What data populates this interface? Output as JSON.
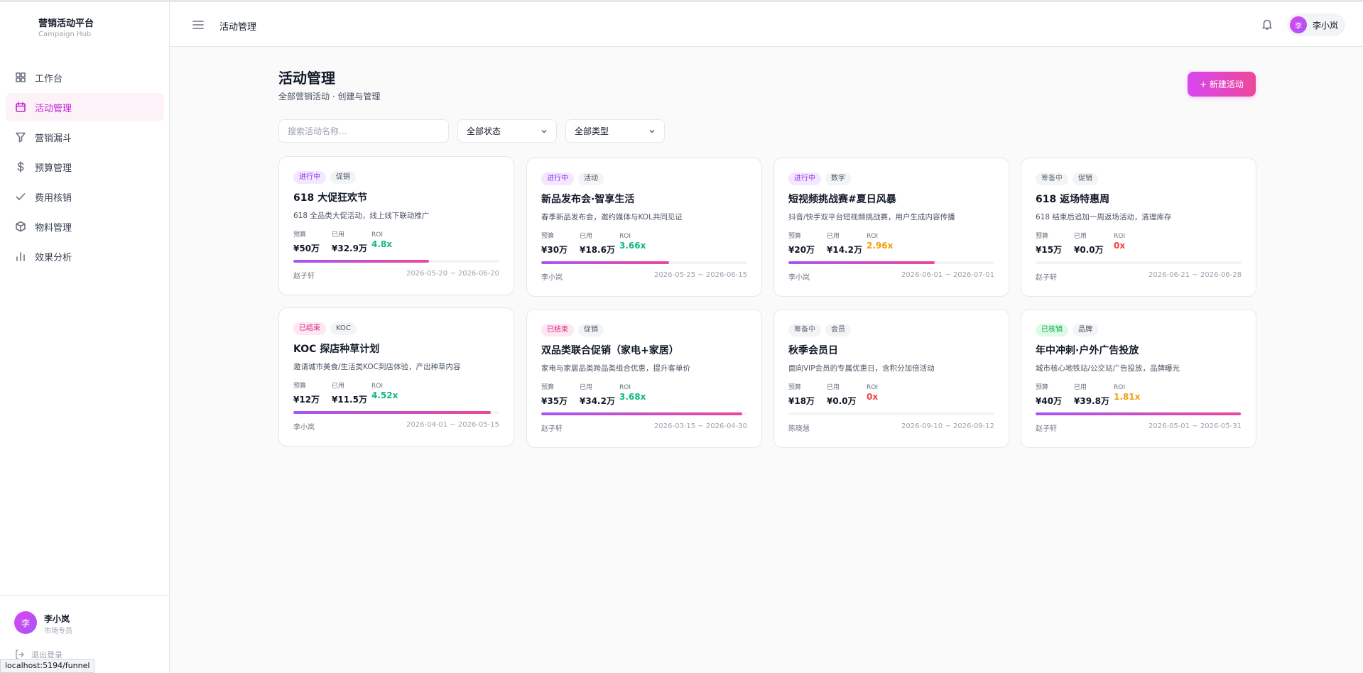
{
  "app": {
    "title": "营销活动平台",
    "subtitle": "Campaign Hub"
  },
  "sidebar": {
    "items": [
      {
        "label": "工作台",
        "icon": "grid-icon",
        "active": false
      },
      {
        "label": "活动管理",
        "icon": "calendar-icon",
        "active": true
      },
      {
        "label": "营销漏斗",
        "icon": "funnel-icon",
        "active": false
      },
      {
        "label": "预算管理",
        "icon": "dollar-icon",
        "active": false
      },
      {
        "label": "费用核销",
        "icon": "check-icon",
        "active": false
      },
      {
        "label": "物料管理",
        "icon": "box-icon",
        "active": false
      },
      {
        "label": "效果分析",
        "icon": "bar-chart-icon",
        "active": false
      }
    ],
    "user": {
      "avatar": "李",
      "name": "李小岚",
      "role": "市场专员"
    },
    "logout": "退出登录"
  },
  "status_url": "localhost:5194/funnel",
  "header": {
    "title": "活动管理",
    "user": {
      "avatar": "李",
      "name": "李小岚"
    }
  },
  "page": {
    "title": "活动管理",
    "subtitle": "全部营销活动 · 创建与管理",
    "new_button": "+ 新建活动",
    "search_placeholder": "搜索活动名称...",
    "status_filter": "全部状态",
    "type_filter": "全部类型"
  },
  "labels": {
    "budget": "预算",
    "spent": "已用",
    "roi": "ROI"
  },
  "colors": {
    "accent": "#c026d3",
    "roi_good": "#10b981",
    "roi_mid": "#f59e0b",
    "roi_zero": "#ef4444"
  },
  "campaigns": [
    {
      "status": "进行中",
      "status_class": "st-active",
      "type": "促销",
      "title": "618 大促狂欢节",
      "desc": "618 全品类大促活动，线上线下联动推广",
      "budget": "¥50万",
      "spent": "¥32.9万",
      "roi": "4.8x",
      "roi_color": "#10b981",
      "progress": 0.658,
      "owner": "赵子轩",
      "dates": "2026-05-20 ~ 2026-06-20"
    },
    {
      "status": "进行中",
      "status_class": "st-active",
      "type": "活动",
      "title": "新品发布会·智享生活",
      "desc": "春季新品发布会，邀约媒体与KOL共同见证",
      "budget": "¥30万",
      "spent": "¥18.6万",
      "roi": "3.66x",
      "roi_color": "#10b981",
      "progress": 0.62,
      "owner": "李小岚",
      "dates": "2026-05-25 ~ 2026-06-15"
    },
    {
      "status": "进行中",
      "status_class": "st-active",
      "type": "数字",
      "title": "短视频挑战赛#夏日风暴",
      "desc": "抖音/快手双平台短视频挑战赛，用户生成内容传播",
      "budget": "¥20万",
      "spent": "¥14.2万",
      "roi": "2.96x",
      "roi_color": "#f59e0b",
      "progress": 0.71,
      "owner": "李小岚",
      "dates": "2026-06-01 ~ 2026-07-01"
    },
    {
      "status": "筹备中",
      "status_class": "st-prep",
      "type": "促销",
      "title": "618 返场特惠周",
      "desc": "618 结束后追加一周返场活动，清理库存",
      "budget": "¥15万",
      "spent": "¥0.0万",
      "roi": "0x",
      "roi_color": "#ef4444",
      "progress": 0,
      "owner": "赵子轩",
      "dates": "2026-06-21 ~ 2026-06-28"
    },
    {
      "status": "已结束",
      "status_class": "st-ended",
      "type": "KOC",
      "title": "KOC 探店种草计划",
      "desc": "邀请城市美食/生活类KOC到店体验，产出种草内容",
      "budget": "¥12万",
      "spent": "¥11.5万",
      "roi": "4.52x",
      "roi_color": "#10b981",
      "progress": 0.958,
      "owner": "李小岚",
      "dates": "2026-04-01 ~ 2026-05-15"
    },
    {
      "status": "已结束",
      "status_class": "st-ended",
      "type": "促销",
      "title": "双品类联合促销（家电+家居）",
      "desc": "家电与家居品类跨品类组合优惠，提升客单价",
      "budget": "¥35万",
      "spent": "¥34.2万",
      "roi": "3.68x",
      "roi_color": "#10b981",
      "progress": 0.977,
      "owner": "赵子轩",
      "dates": "2026-03-15 ~ 2026-04-30"
    },
    {
      "status": "筹备中",
      "status_class": "st-prep",
      "type": "会员",
      "title": "秋季会员日",
      "desc": "面向VIP会员的专属优惠日，含积分加倍活动",
      "budget": "¥18万",
      "spent": "¥0.0万",
      "roi": "0x",
      "roi_color": "#ef4444",
      "progress": 0,
      "owner": "陈晓慧",
      "dates": "2026-09-10 ~ 2026-09-12"
    },
    {
      "status": "已核销",
      "status_class": "st-verified",
      "type": "品牌",
      "title": "年中冲刺·户外广告投放",
      "desc": "城市核心地铁站/公交站广告投放，品牌曝光",
      "budget": "¥40万",
      "spent": "¥39.8万",
      "roi": "1.81x",
      "roi_color": "#f59e0b",
      "progress": 0.995,
      "owner": "赵子轩",
      "dates": "2026-05-01 ~ 2026-05-31"
    }
  ]
}
